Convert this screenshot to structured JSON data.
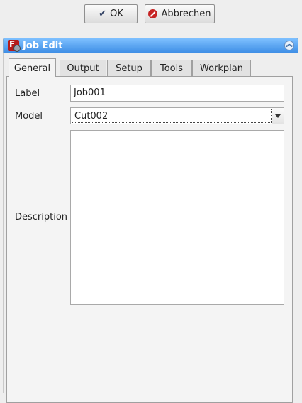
{
  "dialog_buttons": {
    "ok_label": "OK",
    "cancel_label": "Abbrechen"
  },
  "panel": {
    "title": "Job Edit"
  },
  "tabs": [
    {
      "label": "General",
      "active": true
    },
    {
      "label": "Output",
      "active": false
    },
    {
      "label": "Setup",
      "active": false
    },
    {
      "label": "Tools",
      "active": false
    },
    {
      "label": "Workplan",
      "active": false
    }
  ],
  "general": {
    "label_caption": "Label",
    "label_value": "Job001",
    "model_caption": "Model",
    "model_value": "Cut002",
    "description_caption": "Description",
    "description_value": ""
  },
  "colors": {
    "header_start": "#7ec0ff",
    "header_end": "#3f8fe6",
    "cancel_icon": "#c62424"
  }
}
